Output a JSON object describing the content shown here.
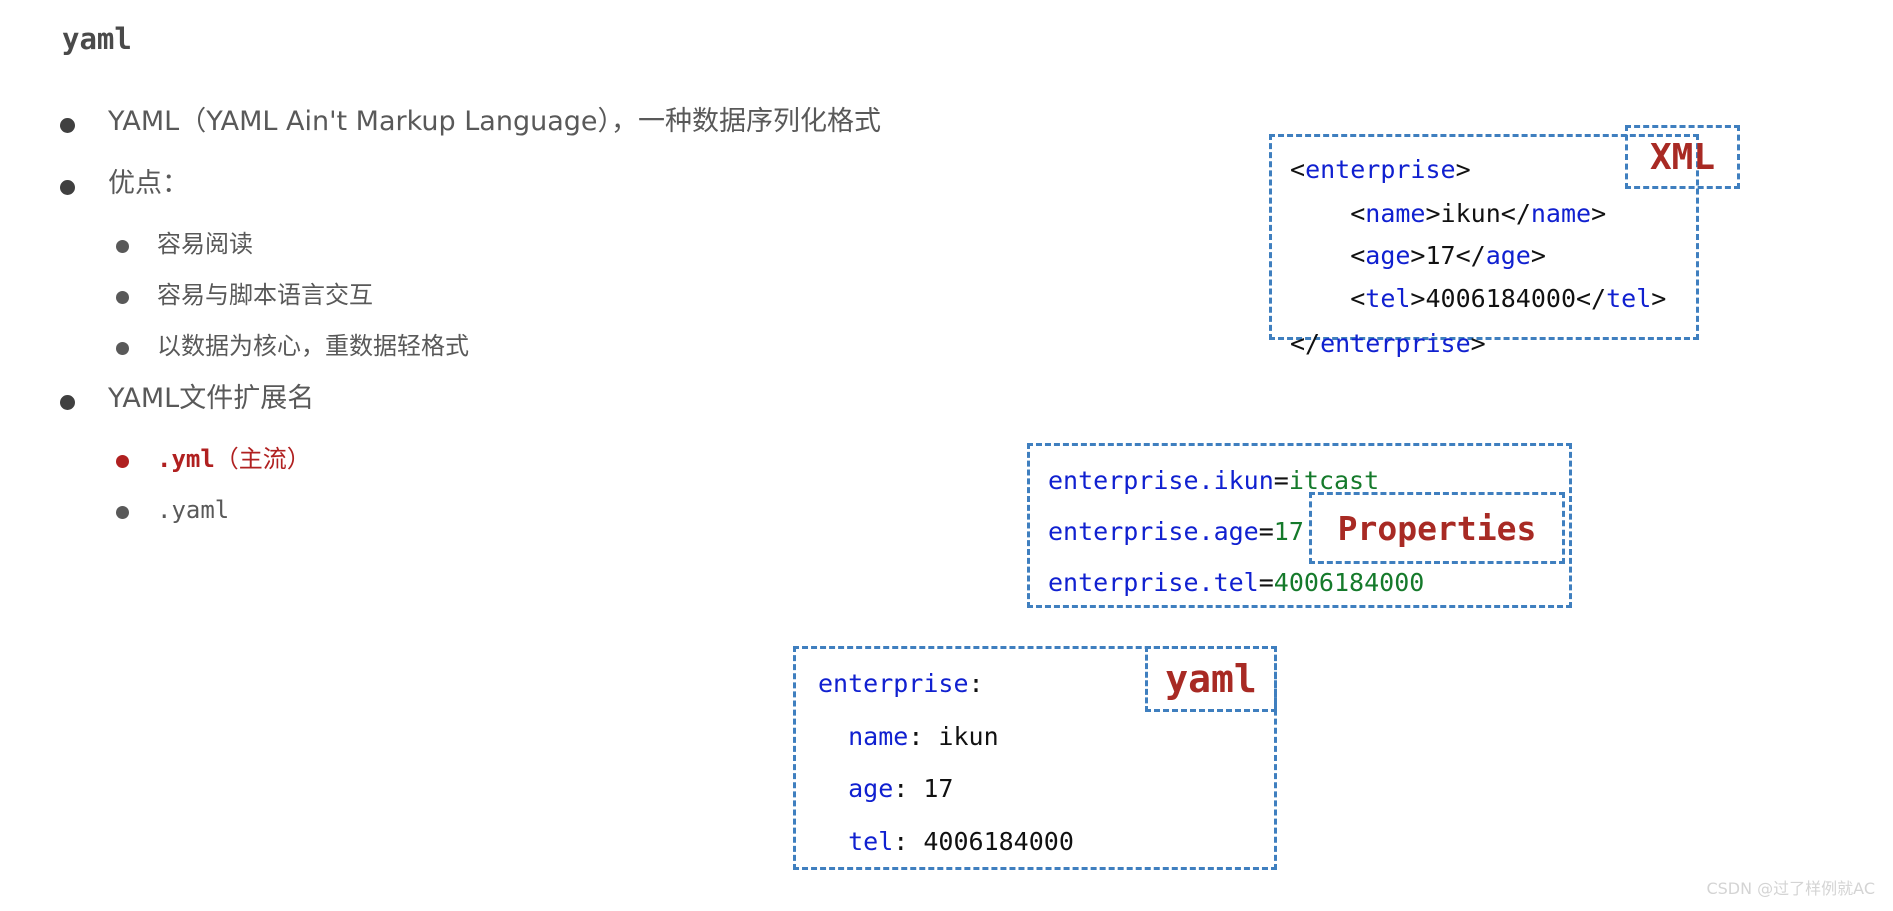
{
  "slide": {
    "title": "yaml"
  },
  "bullets": [
    {
      "level": 1,
      "marker": "dot",
      "marker_color": "#404040",
      "text": "YAML（YAML Ain't Markup Language），一种数据序列化格式"
    },
    {
      "level": 1,
      "marker": "dot",
      "marker_color": "#404040",
      "text": "优点："
    },
    {
      "level": 2,
      "marker": "dot",
      "marker_color": "#595959",
      "text": "容易阅读"
    },
    {
      "level": 2,
      "marker": "dot",
      "marker_color": "#595959",
      "text": "容易与脚本语言交互"
    },
    {
      "level": 2,
      "marker": "dot",
      "marker_color": "#595959",
      "text": "以数据为核心，重数据轻格式"
    },
    {
      "level": 1,
      "marker": "dot",
      "marker_color": "#404040",
      "text": "YAML文件扩展名"
    },
    {
      "level": 2,
      "marker": "dot",
      "marker_color": "#b02020",
      "text": ".yml（主流）",
      "text_mono": ".yml",
      "text_cn": "（主流）",
      "highlight": true
    },
    {
      "level": 2,
      "marker": "dot",
      "marker_color": "#595959",
      "text": ".yaml"
    }
  ],
  "xml_box": {
    "label": "XML",
    "label_color": "#a82a24",
    "border_color": "#3f7fbf",
    "lines": [
      {
        "parts": [
          {
            "t": "<",
            "c": "punc"
          },
          {
            "t": "enterprise",
            "c": "tag"
          },
          {
            "t": ">",
            "c": "punc"
          }
        ]
      },
      {
        "parts": [
          {
            "t": "    <",
            "c": "punc"
          },
          {
            "t": "name",
            "c": "tag"
          },
          {
            "t": ">",
            "c": "punc"
          },
          {
            "t": "ikun",
            "c": "val"
          },
          {
            "t": "</",
            "c": "punc"
          },
          {
            "t": "name",
            "c": "tag"
          },
          {
            "t": ">",
            "c": "punc"
          }
        ]
      },
      {
        "parts": [
          {
            "t": "    <",
            "c": "punc"
          },
          {
            "t": "age",
            "c": "tag"
          },
          {
            "t": ">",
            "c": "punc"
          },
          {
            "t": "17",
            "c": "val"
          },
          {
            "t": "</",
            "c": "punc"
          },
          {
            "t": "age",
            "c": "tag"
          },
          {
            "t": ">",
            "c": "punc"
          }
        ]
      },
      {
        "parts": [
          {
            "t": "    <",
            "c": "punc"
          },
          {
            "t": "tel",
            "c": "tag"
          },
          {
            "t": ">",
            "c": "punc"
          },
          {
            "t": "4006184000",
            "c": "val"
          },
          {
            "t": "</",
            "c": "punc"
          },
          {
            "t": "tel",
            "c": "tag"
          },
          {
            "t": ">",
            "c": "punc"
          }
        ]
      },
      {
        "parts": [
          {
            "t": "</",
            "c": "punc"
          },
          {
            "t": "enterprise",
            "c": "tag"
          },
          {
            "t": ">",
            "c": "punc"
          }
        ]
      }
    ],
    "plain_text": "<enterprise>\n    <name>ikun</name>\n    <age>17</age>\n    <tel>4006184000</tel>\n</enterprise>"
  },
  "properties_box": {
    "label": "Properties",
    "label_color": "#a82a24",
    "border_color": "#3f7fbf",
    "lines": [
      {
        "parts": [
          {
            "t": "enterprise.ikun",
            "c": "key"
          },
          {
            "t": "=",
            "c": "punc"
          },
          {
            "t": "itcast",
            "c": "gval"
          }
        ]
      },
      {
        "parts": [
          {
            "t": "enterprise.age",
            "c": "key"
          },
          {
            "t": "=",
            "c": "punc"
          },
          {
            "t": "17",
            "c": "gval"
          }
        ]
      },
      {
        "parts": [
          {
            "t": "enterprise.tel",
            "c": "key"
          },
          {
            "t": "=",
            "c": "punc"
          },
          {
            "t": "4006184000",
            "c": "gval"
          }
        ]
      }
    ],
    "plain_text": "enterprise.ikun=itcast\nenterprise.age=17\nenterprise.tel=4006184000"
  },
  "yaml_box": {
    "label": "yaml",
    "label_color": "#a82a24",
    "border_color": "#3f7fbf",
    "lines": [
      {
        "parts": [
          {
            "t": "enterprise",
            "c": "key"
          },
          {
            "t": ":",
            "c": "punc"
          }
        ]
      },
      {
        "parts": [
          {
            "t": "  name",
            "c": "key"
          },
          {
            "t": ": ",
            "c": "punc"
          },
          {
            "t": "ikun",
            "c": "val"
          }
        ]
      },
      {
        "parts": [
          {
            "t": "  age",
            "c": "key"
          },
          {
            "t": ": ",
            "c": "punc"
          },
          {
            "t": "17",
            "c": "val"
          }
        ]
      },
      {
        "parts": [
          {
            "t": "  tel",
            "c": "key"
          },
          {
            "t": ": ",
            "c": "punc"
          },
          {
            "t": "4006184000",
            "c": "val"
          }
        ]
      }
    ],
    "plain_text": "enterprise:\n  name: ikun\n  age: 17\n  tel: 4006184000"
  },
  "watermark": {
    "text": "CSDN @过了样例就AC"
  }
}
